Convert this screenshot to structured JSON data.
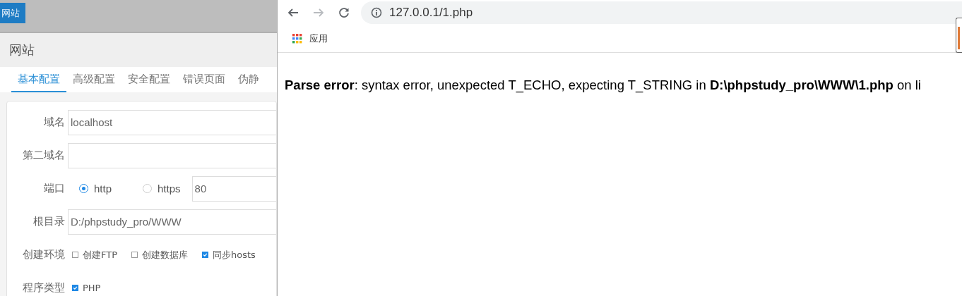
{
  "site_panel": {
    "top_button": "网站",
    "title": "网站",
    "tabs": [
      {
        "label": "基本配置",
        "selected": true
      },
      {
        "label": "高级配置",
        "selected": false
      },
      {
        "label": "安全配置",
        "selected": false
      },
      {
        "label": "错误页面",
        "selected": false
      },
      {
        "label": "伪静",
        "selected": false
      }
    ],
    "form": [
      {
        "kind": "text",
        "label": "域名",
        "value": "localhost"
      },
      {
        "kind": "text",
        "label": "第二域名"
      },
      {
        "kind": "port",
        "label": "端口",
        "options": [
          {
            "label": "http",
            "selected": true
          },
          {
            "label": "https",
            "selected": false
          }
        ],
        "value": "80"
      },
      {
        "kind": "text",
        "label": "根目录",
        "value": "D:/phpstudy_pro/WWW"
      },
      {
        "kind": "checks",
        "label": "创建环境",
        "options": [
          {
            "label": "创建FTP",
            "checked": false
          },
          {
            "label": "创建数据库",
            "checked": false
          },
          {
            "label": "同步hosts",
            "checked": true
          }
        ]
      },
      {
        "kind": "checks",
        "label": "程序类型",
        "options": [
          {
            "label": "PHP",
            "checked": true
          }
        ]
      }
    ]
  },
  "browser": {
    "nav": [
      {
        "kind": "back",
        "disabled": false
      },
      {
        "kind": "forward",
        "disabled": true
      },
      {
        "kind": "reload",
        "disabled": false
      }
    ],
    "address": "127.0.0.1/1.php",
    "bookmarks": [
      {
        "label": "应用"
      }
    ],
    "error": "**Parse error**: syntax error, unexpected T_ECHO, expecting T_STRING in **D:\\phpstudy_pro\\WWW\\1.php** on li"
  }
}
